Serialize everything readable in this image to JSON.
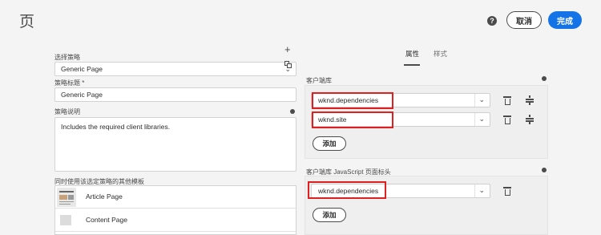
{
  "header": {
    "title": "页",
    "help_icon": "?",
    "cancel_label": "取消",
    "done_label": "完成"
  },
  "left": {
    "select_policy_label": "选择策略",
    "policy_select_value": "Generic Page",
    "policy_title_label": "策略标题 *",
    "policy_title_value": "Generic Page",
    "policy_desc_label": "策略说明",
    "policy_desc_value": "Includes the required client libraries.",
    "other_templates_label": "同时使用该选定策略的其他模板",
    "templates": [
      {
        "label": "Article Page"
      },
      {
        "label": "Content Page"
      }
    ]
  },
  "right": {
    "tabs": [
      {
        "label": "属性",
        "active": true
      },
      {
        "label": "样式",
        "active": false
      }
    ],
    "client_libs_label": "客户端库",
    "client_libs": [
      {
        "value": "wknd.dependencies"
      },
      {
        "value": "wknd.site"
      }
    ],
    "add_label_1": "添加",
    "head_libs_label": "客户端库 JavaScript 页面标头",
    "head_libs": [
      {
        "value": "wknd.dependencies"
      }
    ],
    "add_label_2": "添加"
  },
  "colors": {
    "accent": "#1473e6",
    "highlight": "#e02020",
    "background": "#f4f4f4"
  }
}
